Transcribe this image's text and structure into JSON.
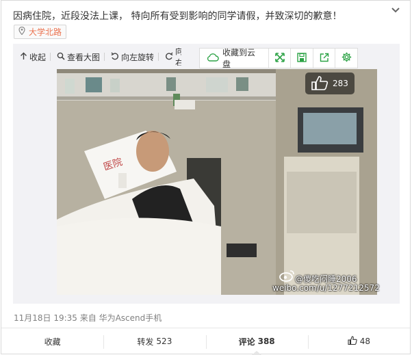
{
  "post": {
    "text": "因病住院，近段没法上课， 特向所有受到影响的同学请假，并致深切的歉意！",
    "location": "大学北路",
    "meta": "11月18日 19:35 来自 华为Ascend手机"
  },
  "media_toolbar": {
    "collapse": "收起",
    "view_large": "查看大图",
    "rotate_left": "向左旋转",
    "rotate_right": "向右"
  },
  "cloud_bar": {
    "save_label": "收藏到云盘"
  },
  "photo": {
    "like_count": "283",
    "watermark_name": "@傻吃闷睡2006",
    "watermark_url": "weibo.com/u/1277212572",
    "pillow_text": "医院"
  },
  "actions": {
    "favorite": "收藏",
    "repost_label": "转发",
    "repost_count": "523",
    "comment_label": "评论",
    "comment_count": "388",
    "like_count": "48"
  },
  "colors": {
    "location_text": "#eb7350",
    "cloud_green": "#2ba245",
    "meta_gray": "#808080"
  }
}
